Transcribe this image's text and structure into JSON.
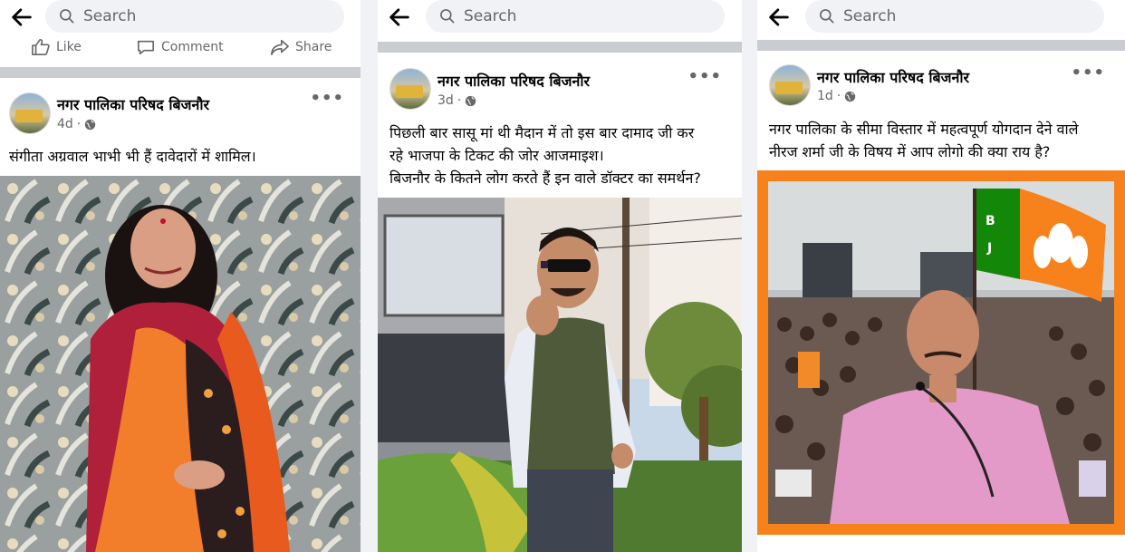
{
  "search": {
    "placeholder": "Search"
  },
  "actions": {
    "like": "Like",
    "comment": "Comment",
    "share": "Share"
  },
  "posts": [
    {
      "page_name": "नगर पालिका परिषद बिजनौर",
      "time": "4d",
      "dot": "·",
      "more": "•••",
      "caption": [
        "संगीता अग्रवाल भाभी भी हैं दावेदारों में शामिल।"
      ]
    },
    {
      "page_name": "नगर पालिका परिषद बिजनौर",
      "time": "3d",
      "dot": "·",
      "more": "•••",
      "caption": [
        "पिछली बार सासू मां थी मैदान में तो इस बार दामाद जी कर",
        "रहे भाजपा के टिकट की जोर आजमाइश।",
        "बिजनौर के कितने लोग करते हैं इन वाले डॉक्टर का समर्थन?"
      ]
    },
    {
      "page_name": "नगर पालिका परिषद बिजनौर",
      "time": "1d",
      "dot": "·",
      "more": "•••",
      "caption": [
        "नगर पालिका के सीमा विस्तार में महत्वपूर्ण योगदान देने वाले",
        "नीरज शर्मा जी के विषय में आप लोगो की क्या राय है?"
      ]
    }
  ],
  "colors": {
    "bjp_saffron": "#f7821b",
    "bjp_green": "#138808",
    "separator": "#c9ccd1"
  }
}
